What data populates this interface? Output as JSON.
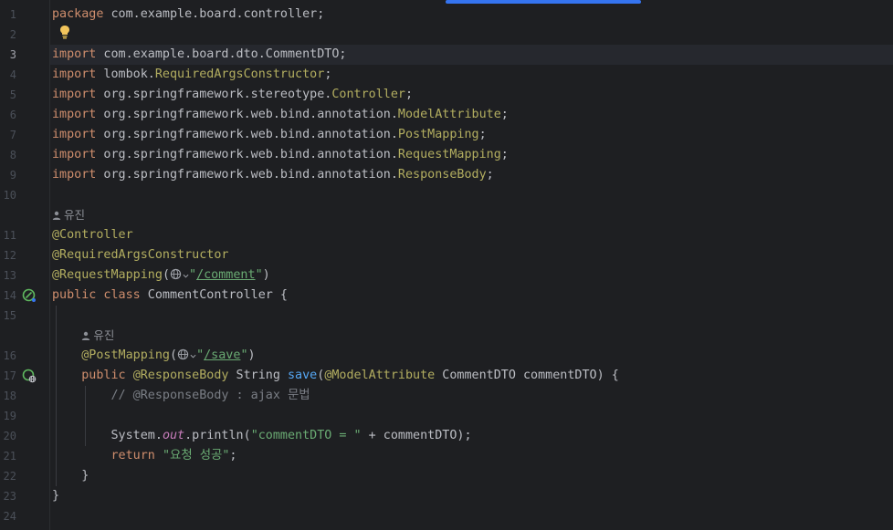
{
  "editor": {
    "lines": [
      {
        "n": "1",
        "tokens": [
          {
            "t": "package",
            "c": "kw"
          },
          {
            "t": " com.example.board.controller;",
            "c": "pl"
          }
        ]
      },
      {
        "n": "2",
        "tokens": []
      },
      {
        "n": "3",
        "current": true,
        "tokens": [
          {
            "t": "import",
            "c": "kw"
          },
          {
            "t": " com.example.board.dto.CommentDTO;",
            "c": "pl"
          }
        ]
      },
      {
        "n": "4",
        "tokens": [
          {
            "t": "import",
            "c": "kw"
          },
          {
            "t": " lombok.",
            "c": "pl"
          },
          {
            "t": "RequiredArgsConstructor",
            "c": "ann"
          },
          {
            "t": ";",
            "c": "pl"
          }
        ]
      },
      {
        "n": "5",
        "tokens": [
          {
            "t": "import",
            "c": "kw"
          },
          {
            "t": " org.springframework.stereotype.",
            "c": "pl"
          },
          {
            "t": "Controller",
            "c": "ann"
          },
          {
            "t": ";",
            "c": "pl"
          }
        ]
      },
      {
        "n": "6",
        "tokens": [
          {
            "t": "import",
            "c": "kw"
          },
          {
            "t": " org.springframework.web.bind.annotation.",
            "c": "pl"
          },
          {
            "t": "ModelAttribute",
            "c": "ann"
          },
          {
            "t": ";",
            "c": "pl"
          }
        ]
      },
      {
        "n": "7",
        "tokens": [
          {
            "t": "import",
            "c": "kw"
          },
          {
            "t": " org.springframework.web.bind.annotation.",
            "c": "pl"
          },
          {
            "t": "PostMapping",
            "c": "ann"
          },
          {
            "t": ";",
            "c": "pl"
          }
        ]
      },
      {
        "n": "8",
        "tokens": [
          {
            "t": "import",
            "c": "kw"
          },
          {
            "t": " org.springframework.web.bind.annotation.",
            "c": "pl"
          },
          {
            "t": "RequestMapping",
            "c": "ann"
          },
          {
            "t": ";",
            "c": "pl"
          }
        ]
      },
      {
        "n": "9",
        "tokens": [
          {
            "t": "import",
            "c": "kw"
          },
          {
            "t": " org.springframework.web.bind.annotation.",
            "c": "pl"
          },
          {
            "t": "ResponseBody",
            "c": "ann"
          },
          {
            "t": ";",
            "c": "pl"
          }
        ]
      },
      {
        "n": "10",
        "tokens": []
      },
      {
        "n": "",
        "inlay": "유진",
        "indent": ""
      },
      {
        "n": "11",
        "tokens": [
          {
            "t": "@Controller",
            "c": "ann"
          }
        ]
      },
      {
        "n": "12",
        "tokens": [
          {
            "t": "@RequiredArgsConstructor",
            "c": "ann"
          }
        ]
      },
      {
        "n": "13",
        "tokens": [
          {
            "t": "@RequestMapping",
            "c": "ann"
          },
          {
            "t": "(",
            "c": "pl"
          },
          {
            "globe": true
          },
          {
            "t": "\"",
            "c": "str"
          },
          {
            "t": "/comment",
            "c": "lnk"
          },
          {
            "t": "\"",
            "c": "str"
          },
          {
            "t": ")",
            "c": "pl"
          }
        ]
      },
      {
        "n": "14",
        "icon": "bean",
        "tokens": [
          {
            "t": "public class",
            "c": "kw"
          },
          {
            "t": " CommentController {",
            "c": "pl"
          }
        ]
      },
      {
        "n": "15",
        "tokens": []
      },
      {
        "n": "",
        "inlay": "유진",
        "indent": "    "
      },
      {
        "n": "16",
        "tokens": [
          {
            "t": "    ",
            "c": "pl"
          },
          {
            "t": "@PostMapping",
            "c": "ann"
          },
          {
            "t": "(",
            "c": "pl"
          },
          {
            "globe": true
          },
          {
            "t": "\"",
            "c": "str"
          },
          {
            "t": "/save",
            "c": "lnk"
          },
          {
            "t": "\"",
            "c": "str"
          },
          {
            "t": ")",
            "c": "pl"
          }
        ]
      },
      {
        "n": "17",
        "icon": "endpoint",
        "tokens": [
          {
            "t": "    ",
            "c": "pl"
          },
          {
            "t": "public",
            "c": "kw"
          },
          {
            "t": " ",
            "c": "pl"
          },
          {
            "t": "@ResponseBody",
            "c": "ann"
          },
          {
            "t": " String ",
            "c": "pl"
          },
          {
            "t": "save",
            "c": "fn"
          },
          {
            "t": "(",
            "c": "pl"
          },
          {
            "t": "@ModelAttribute",
            "c": "ann"
          },
          {
            "t": " CommentDTO commentDTO) {",
            "c": "pl"
          }
        ]
      },
      {
        "n": "18",
        "tokens": [
          {
            "t": "        ",
            "c": "pl"
          },
          {
            "t": "// @ResponseBody : ajax 문법",
            "c": "cm"
          }
        ]
      },
      {
        "n": "19",
        "tokens": []
      },
      {
        "n": "20",
        "tokens": [
          {
            "t": "        System.",
            "c": "pl"
          },
          {
            "t": "out",
            "c": "static"
          },
          {
            "t": ".println(",
            "c": "pl"
          },
          {
            "t": "\"commentDTO = \"",
            "c": "str"
          },
          {
            "t": " + commentDTO);",
            "c": "pl"
          }
        ]
      },
      {
        "n": "21",
        "tokens": [
          {
            "t": "        ",
            "c": "pl"
          },
          {
            "t": "return",
            "c": "kw"
          },
          {
            "t": " ",
            "c": "pl"
          },
          {
            "t": "\"요청 성공\"",
            "c": "str"
          },
          {
            "t": ";",
            "c": "pl"
          }
        ]
      },
      {
        "n": "22",
        "tokens": [
          {
            "t": "    }",
            "c": "pl"
          }
        ]
      },
      {
        "n": "23",
        "tokens": [
          {
            "t": "}",
            "c": "pl"
          }
        ]
      },
      {
        "n": "24",
        "tokens": []
      }
    ]
  },
  "colors": {
    "background": "#1e1f22",
    "keyword": "#cf8e6d",
    "annotation": "#b3ae60",
    "string": "#6aab73",
    "comment": "#7a7e85",
    "function": "#56a8f5",
    "accent": "#3574f0"
  },
  "icons": {
    "intention": "lightbulb-icon",
    "class_gutter": "spring-bean-icon",
    "method_gutter": "endpoint-icon",
    "author": "person-icon",
    "url": "globe-icon"
  }
}
